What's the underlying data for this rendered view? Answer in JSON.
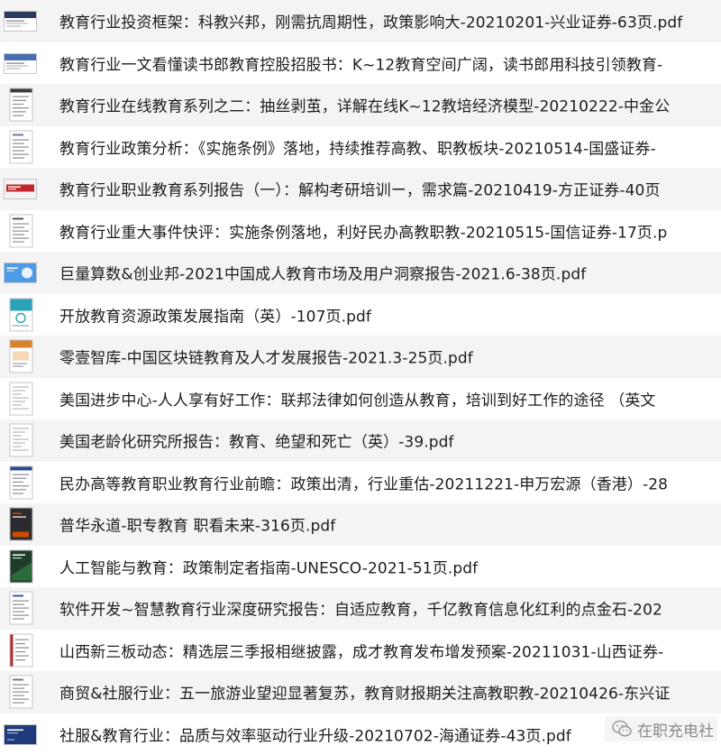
{
  "files": [
    {
      "name": "教育行业投资框架：科教兴邦，刚需抗周期性，政策影响大-20210201-兴业证券-63页.pdf",
      "thumb": "wide-report",
      "accent": "#2a3b5c"
    },
    {
      "name": "教育行业一文看懂读书郎教育控股招股书：K~12教育空间广阔，读书郎用科技引领教育-",
      "thumb": "wide-report",
      "accent": "#4a6fb0"
    },
    {
      "name": "教育行业在线教育系列之二：抽丝剥茧，详解在线K~12教培经济模型-20210222-中金公",
      "thumb": "doc-bar",
      "accent": "#3b3b3b"
    },
    {
      "name": "教育行业政策分析：《实施条例》落地，持续推荐高教、职教板块-20210514-国盛证券-",
      "thumb": "doc-lines",
      "accent": "#6b7a99"
    },
    {
      "name": "教育行业职业教育系列报告（一）：解构考研培训ー，需求篇-20210419-方正证券-40页",
      "thumb": "wide-red",
      "accent": "#c0282d"
    },
    {
      "name": "教育行业重大事件快评：实施条例落地，利好民办高教职教-20210515-国信证券-17页.p",
      "thumb": "doc-lines",
      "accent": "#555555"
    },
    {
      "name": "巨量算数&创业邦-2021中国成人教育市场及用户洞察报告-2021.6-38页.pdf",
      "thumb": "wide-blue",
      "accent": "#2d7fd6"
    },
    {
      "name": "开放教育资源政策发展指南（英）-107页.pdf",
      "thumb": "doc-teal",
      "accent": "#2aa3b8"
    },
    {
      "name": "零壹智库-中国区块链教育及人才发展报告-2021.3-25页.pdf",
      "thumb": "doc-orange",
      "accent": "#d9822b"
    },
    {
      "name": "美国进步中心-人人享有好工作：联邦法律如何创造从教育，培训到好工作的途径 （英文",
      "thumb": "doc-plain",
      "accent": "#888888"
    },
    {
      "name": "美国老龄化研究所报告：教育、绝望和死亡（英）-39.pdf",
      "thumb": "doc-plain",
      "accent": "#999999"
    },
    {
      "name": "民办高等教育职业教育行业前瞻：政策出清，行业重估-20211221-申万宏源（香港）-28",
      "thumb": "doc-bar",
      "accent": "#2b4a8a"
    },
    {
      "name": "普华永道-职专教育 职看未来-316页.pdf",
      "thumb": "doc-dark",
      "accent": "#d04a02"
    },
    {
      "name": "人工智能与教育：政策制定者指南-UNESCO-2021-51页.pdf",
      "thumb": "doc-green",
      "accent": "#2e6b3a"
    },
    {
      "name": "软件开发~智慧教育行业深度研究报告：自适应教育，千亿教育信息化红利的点金石-202",
      "thumb": "doc-lines",
      "accent": "#3a5fa0"
    },
    {
      "name": "山西新三板动态：精选层三季报相继披露，成才教育发布增发预案-20211031-山西证券-",
      "thumb": "doc-red",
      "accent": "#b02a2a"
    },
    {
      "name": "商贸&社服行业：五一旅游业望迎显著复苏，教育财报期关注高教职教-20210426-东兴证",
      "thumb": "doc-lines",
      "accent": "#777777"
    },
    {
      "name": "社服&教育行业：品质与效率驱动行业升级-20210702-海通证券-43页.pdf",
      "thumb": "wide-navy",
      "accent": "#1f3a7a"
    }
  ],
  "watermark": {
    "text": "在职充电社",
    "icon": "wechat-icon"
  }
}
